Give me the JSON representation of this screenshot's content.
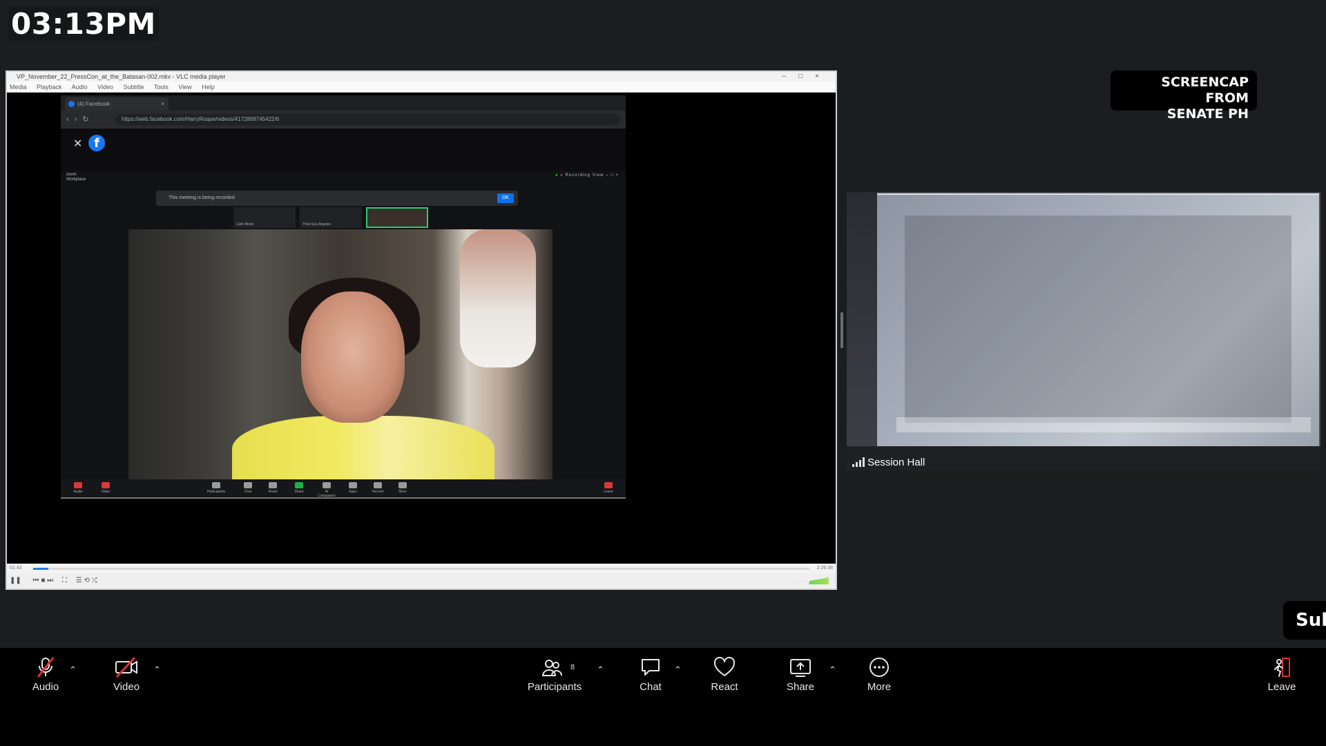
{
  "overlay": {
    "clock": "03:13PM",
    "watermark_line1": "SCREENCAP FROM",
    "watermark_line2": "SENATE PH",
    "subtitle_tab": "Sub"
  },
  "vlc": {
    "title": "VP_November_22_PressCon_at_the_Batasan-002.mkv - VLC media player",
    "menu": [
      "Media",
      "Playback",
      "Audio",
      "Video",
      "Subtitle",
      "Tools",
      "View",
      "Help"
    ],
    "time_elapsed": "01:43",
    "time_total": "2:26:38",
    "progress_fraction": 0.01
  },
  "browser": {
    "tab_title": "(4) Facebook",
    "url": "https://web.facebook.com/HarryRoque/videos/4172869745422/6"
  },
  "zoom_inner": {
    "brand_line1": "zoom",
    "brand_line2": "Workplace",
    "recording_label": "Recording",
    "view_label": "View",
    "notice": "This meeting is being recorded",
    "notice_ok": "OK",
    "thumb1_name": "Cath Miniel",
    "thumb2_name": "Third Guy Angeles",
    "toolbar": [
      "Audio",
      "Video",
      "Participants",
      "Chat",
      "React",
      "Share",
      "AI Companion",
      "Apps",
      "Record",
      "More",
      "Leave"
    ]
  },
  "camera_tile": {
    "label": "Session Hall"
  },
  "toolbar": {
    "audio": "Audio",
    "video": "Video",
    "participants": "Participants",
    "participants_count": "8",
    "chat": "Chat",
    "react": "React",
    "share": "Share",
    "more": "More",
    "leave": "Leave"
  },
  "colors": {
    "toolbar_bg": "#000000",
    "muted_red": "#e03131",
    "zoom_blue": "#0e71eb",
    "active_green": "#2ecc71"
  }
}
